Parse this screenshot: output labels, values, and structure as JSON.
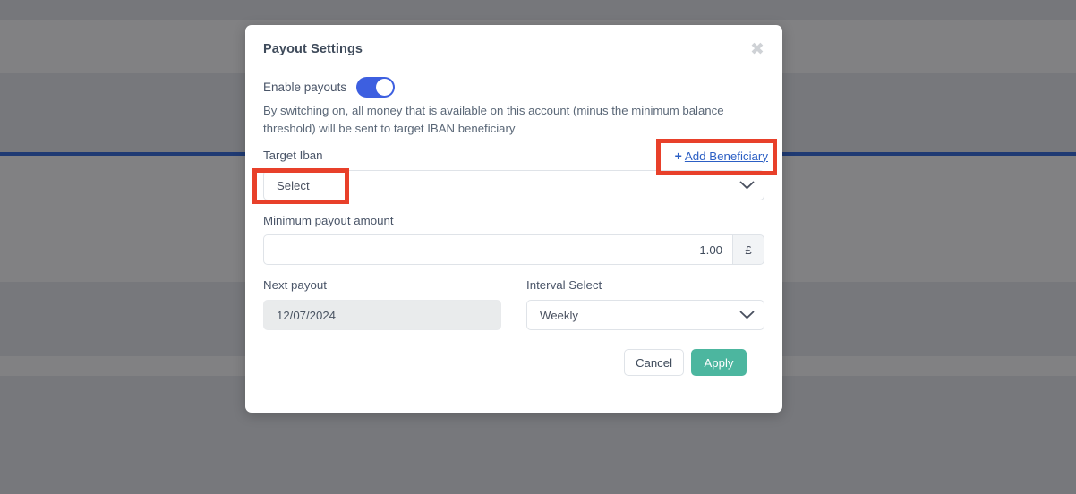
{
  "modal": {
    "title": "Payout Settings",
    "close_icon": "close-icon",
    "enable": {
      "label": "Enable payouts",
      "state": "on",
      "accent_color": "#3d5fe0"
    },
    "description": "By switching on, all money that is available on this account (minus the minimum balance threshold) will be sent to target IBAN beneficiary",
    "target_iban": {
      "label": "Target Iban",
      "selected": "Select",
      "chevron_icon": "chevron-down-icon"
    },
    "add_beneficiary": {
      "plus_icon": "+",
      "label": "Add Beneficiary",
      "color": "#2c5fc4"
    },
    "minimum_payout": {
      "label": "Minimum payout amount",
      "value": "1.00",
      "currency": "£"
    },
    "next_payout": {
      "label": "Next payout",
      "value": "12/07/2024"
    },
    "interval": {
      "label": "Interval Select",
      "selected": "Weekly",
      "chevron_icon": "chevron-down-icon"
    },
    "buttons": {
      "cancel": "Cancel",
      "apply": "Apply",
      "apply_color": "#4cb69f"
    }
  },
  "annotations": {
    "highlight_color": "#e8402a",
    "boxes": [
      {
        "name": "select-highlight"
      },
      {
        "name": "add-beneficiary-highlight"
      }
    ]
  },
  "background": {
    "overlay_color": "#7e7f81",
    "divider_color": "#1f3a73"
  }
}
